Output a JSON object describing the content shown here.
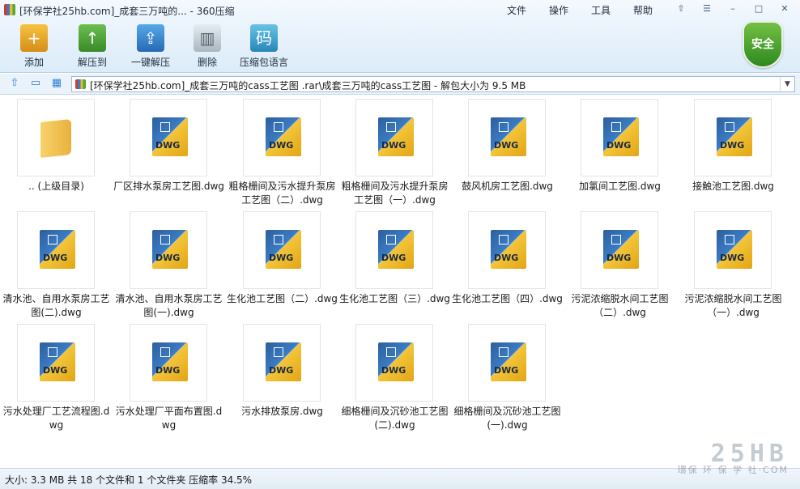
{
  "window": {
    "title": "[环保学社25hb.com]_成套三万吨的... - 360压缩",
    "menu": [
      "文件",
      "操作",
      "工具",
      "帮助"
    ],
    "controls": [
      "⇧",
      "☰",
      "–",
      "□",
      "✕"
    ]
  },
  "toolbar": {
    "buttons": [
      {
        "label": "添加",
        "icon": "add-archive-icon"
      },
      {
        "label": "解压到",
        "icon": "extract-to-icon"
      },
      {
        "label": "一键解压",
        "icon": "one-click-extract-icon"
      },
      {
        "label": "删除",
        "icon": "trash-icon"
      },
      {
        "label": "压缩包语言",
        "icon": "archive-language-icon",
        "glyph": "码"
      }
    ],
    "security_badge": "安全"
  },
  "address_bar": {
    "path": "[环保学社25hb.com]_成套三万吨的cass工艺图 .rar\\成套三万吨的cass工艺图 - 解包大小为 9.5 MB"
  },
  "files": [
    {
      "name": ".. (上级目录)",
      "type": "folder"
    },
    {
      "name": "厂区排水泵房工艺图.dwg",
      "type": "dwg"
    },
    {
      "name": "粗格栅间及污水提升泵房工艺图（二）.dwg",
      "type": "dwg"
    },
    {
      "name": "粗格栅间及污水提升泵房工艺图（一）.dwg",
      "type": "dwg"
    },
    {
      "name": "鼓风机房工艺图.dwg",
      "type": "dwg"
    },
    {
      "name": "加氯间工艺图.dwg",
      "type": "dwg"
    },
    {
      "name": "接触池工艺图.dwg",
      "type": "dwg"
    },
    {
      "name": "清水池、自用水泵房工艺图(二).dwg",
      "type": "dwg"
    },
    {
      "name": "清水池、自用水泵房工艺图(一).dwg",
      "type": "dwg"
    },
    {
      "name": "生化池工艺图（二）.dwg",
      "type": "dwg"
    },
    {
      "name": "生化池工艺图（三）.dwg",
      "type": "dwg"
    },
    {
      "name": "生化池工艺图（四）.dwg",
      "type": "dwg"
    },
    {
      "name": "污泥浓缩脱水间工艺图（二）.dwg",
      "type": "dwg"
    },
    {
      "name": "污泥浓缩脱水间工艺图（一）.dwg",
      "type": "dwg"
    },
    {
      "name": "污水处理厂工艺流程图.dwg",
      "type": "dwg"
    },
    {
      "name": "污水处理厂平面布置图.dwg",
      "type": "dwg"
    },
    {
      "name": "污水排放泵房.dwg",
      "type": "dwg"
    },
    {
      "name": "细格栅间及沉砂池工艺图(二).dwg",
      "type": "dwg"
    },
    {
      "name": "细格栅间及沉砂池工艺图(一).dwg",
      "type": "dwg"
    }
  ],
  "file_badge": "DWG",
  "status": {
    "text": "大小: 3.3 MB 共 18 个文件和 1 个文件夹 压缩率 34.5%"
  },
  "watermark": {
    "big": "25HB",
    "small": "環保 环 保 学 社·COM"
  }
}
